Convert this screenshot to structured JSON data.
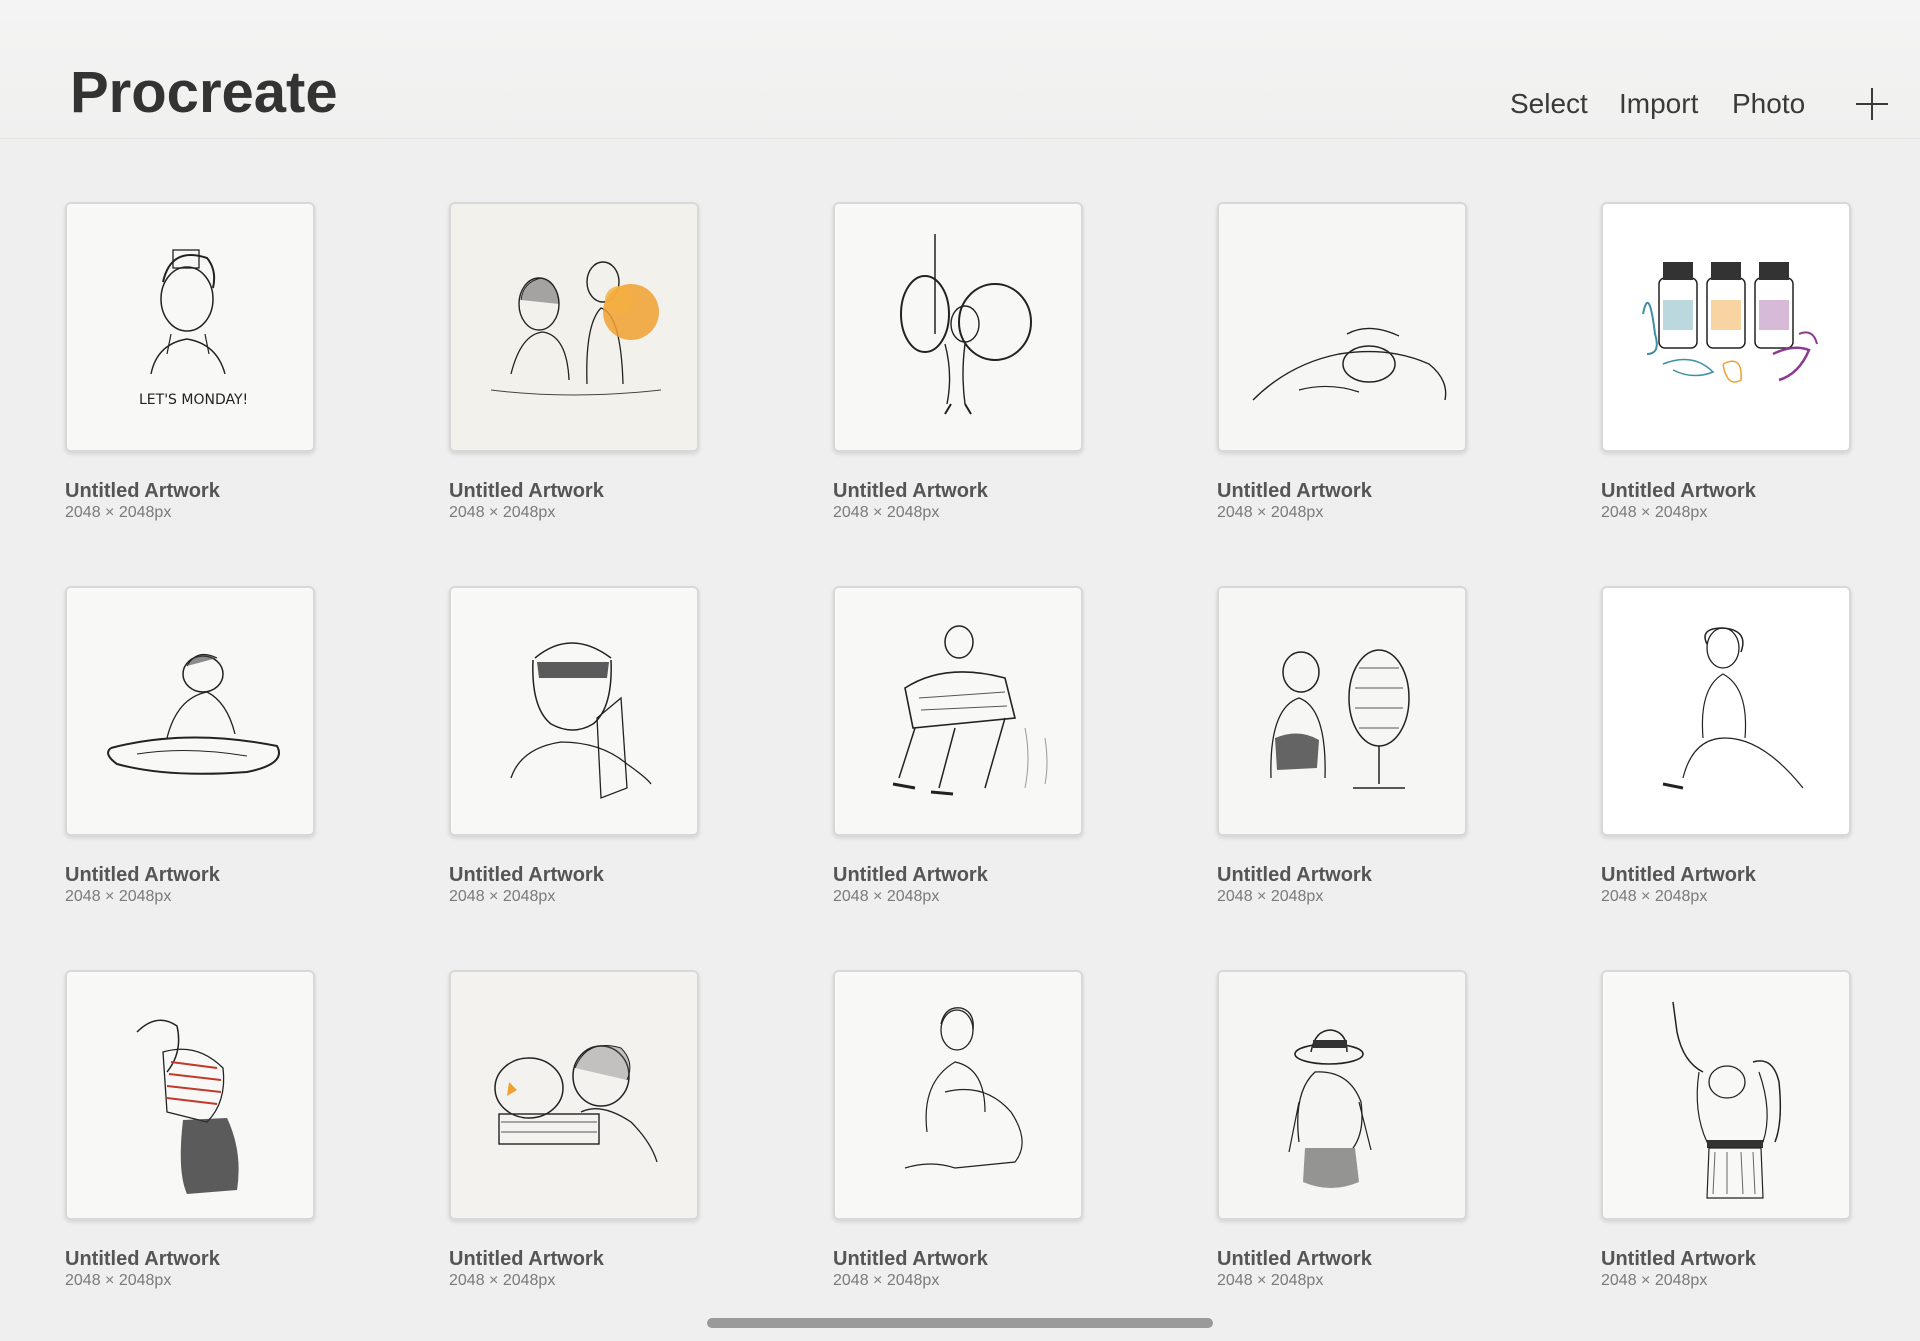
{
  "app": {
    "title": "Procreate"
  },
  "toolbar": {
    "select_label": "Select",
    "import_label": "Import",
    "photo_label": "Photo",
    "add_icon": "plus-icon"
  },
  "gallery": {
    "items": [
      {
        "title": "Untitled Artwork",
        "size": "2048 × 2048px",
        "thumb": "boy-portrait-lets-monday"
      },
      {
        "title": "Untitled Artwork",
        "size": "2048 × 2048px",
        "thumb": "two-children-orange-bouquet"
      },
      {
        "title": "Untitled Artwork",
        "size": "2048 × 2048px",
        "thumb": "girl-with-rings"
      },
      {
        "title": "Untitled Artwork",
        "size": "2048 × 2048px",
        "thumb": "girl-lying-down"
      },
      {
        "title": "Untitled Artwork",
        "size": "2048 × 2048px",
        "thumb": "ink-bottles-colored"
      },
      {
        "title": "Untitled Artwork",
        "size": "2048 × 2048px",
        "thumb": "person-drawing"
      },
      {
        "title": "Untitled Artwork",
        "size": "2048 × 2048px",
        "thumb": "girl-with-cap"
      },
      {
        "title": "Untitled Artwork",
        "size": "2048 × 2048px",
        "thumb": "man-seated-newspaper"
      },
      {
        "title": "Untitled Artwork",
        "size": "2048 × 2048px",
        "thumb": "boy-with-fan"
      },
      {
        "title": "Untitled Artwork",
        "size": "2048 × 2048px",
        "thumb": "woman-sitting-pose"
      },
      {
        "title": "Untitled Artwork",
        "size": "2048 × 2048px",
        "thumb": "girl-striped-shirt"
      },
      {
        "title": "Untitled Artwork",
        "size": "2048 × 2048px",
        "thumb": "boy-fishbowl"
      },
      {
        "title": "Untitled Artwork",
        "size": "2048 × 2048px",
        "thumb": "woman-sitting-hugging-knees"
      },
      {
        "title": "Untitled Artwork",
        "size": "2048 × 2048px",
        "thumb": "woman-straw-hat"
      },
      {
        "title": "Untitled Artwork",
        "size": "2048 × 2048px",
        "thumb": "person-stretching"
      }
    ]
  },
  "colors": {
    "background": "#efefef",
    "text_primary": "#333333",
    "accent_orange": "#f0a030",
    "accent_teal": "#3d8fa3",
    "accent_purple": "#8a3a8f"
  }
}
